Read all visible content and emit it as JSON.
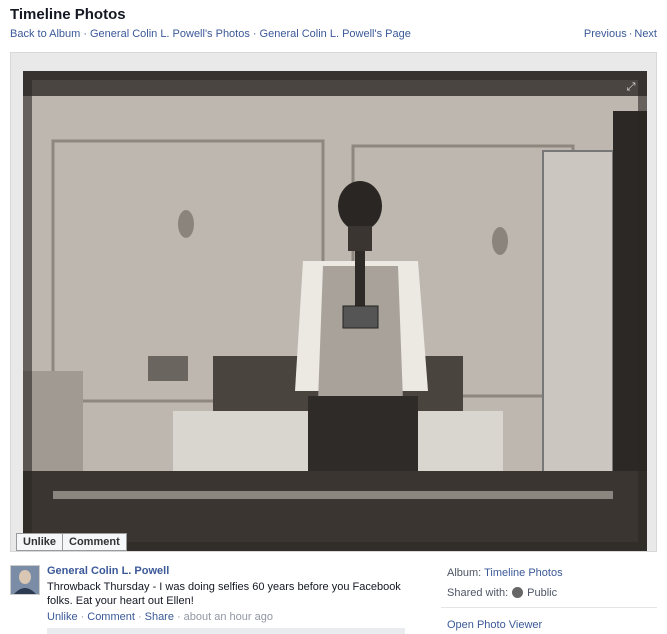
{
  "page": {
    "title": "Timeline Photos"
  },
  "breadcrumb": {
    "back": "Back to Album",
    "photos": "General Colin L. Powell's Photos",
    "page": "General Colin L. Powell's Page",
    "separator": "·"
  },
  "pager": {
    "previous": "Previous",
    "separator": "·",
    "next": "Next"
  },
  "photo_actions": {
    "unlike": "Unlike",
    "comment": "Comment"
  },
  "post": {
    "author": "General Colin L. Powell",
    "caption": "Throwback Thursday - I was doing selfies 60 years before you Facebook folks. Eat your heart out Ellen!",
    "unlike": "Unlike",
    "comment": "Comment",
    "share": "Share",
    "separator": "·",
    "time": "about an hour ago"
  },
  "meta": {
    "album_label": "Album:",
    "album_value": "Timeline Photos",
    "shared_label": "Shared with:",
    "shared_value": "Public",
    "open_viewer": "Open Photo Viewer"
  },
  "icons": {
    "fullscreen": "expand-icon",
    "privacy": "globe-icon"
  },
  "colors": {
    "link": "#3b5998",
    "muted": "#9197a3"
  }
}
